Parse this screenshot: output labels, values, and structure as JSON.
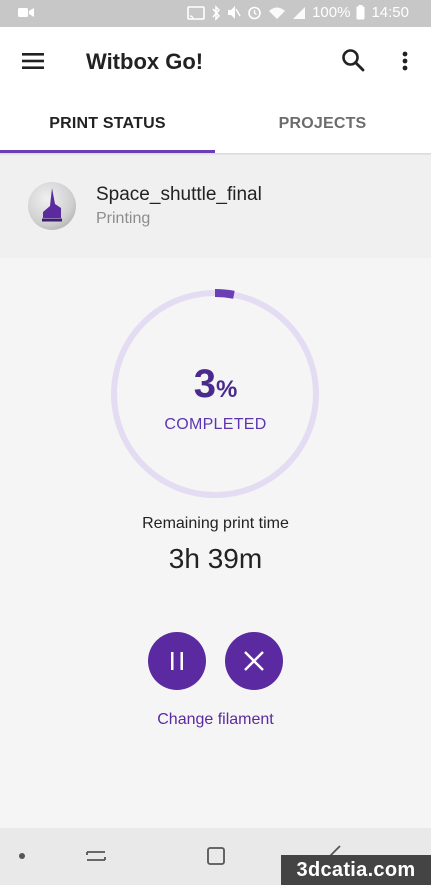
{
  "status_bar": {
    "battery": "100%",
    "time": "14:50",
    "icons": [
      "video-camera-icon",
      "cast-icon",
      "bluetooth-icon",
      "mute-icon",
      "alarm-icon",
      "wifi-icon",
      "signal-icon",
      "battery-icon"
    ]
  },
  "app_bar": {
    "title": "Witbox Go!",
    "icons": [
      "menu-icon",
      "search-icon",
      "more-vert-icon"
    ]
  },
  "tabs": [
    {
      "label": "PRINT STATUS",
      "active": true
    },
    {
      "label": "PROJECTS",
      "active": false
    }
  ],
  "job": {
    "name": "Space_shuttle_final",
    "state": "Printing"
  },
  "progress": {
    "value": "3",
    "unit": "%",
    "fraction": 0.03,
    "label": "COMPLETED"
  },
  "remaining": {
    "label": "Remaining print time",
    "value": "3h 39m"
  },
  "actions": {
    "pause_icon": "pause-icon",
    "cancel_icon": "close-icon",
    "change_filament": "Change filament"
  },
  "nav": {
    "icons": [
      "recents-icon",
      "home-icon",
      "back-icon"
    ]
  },
  "watermark": "3dcatia.com",
  "colors": {
    "accent": "#5b2aa1",
    "ring_track": "#e4dcf3",
    "ring_progress": "#6c3eb6"
  }
}
